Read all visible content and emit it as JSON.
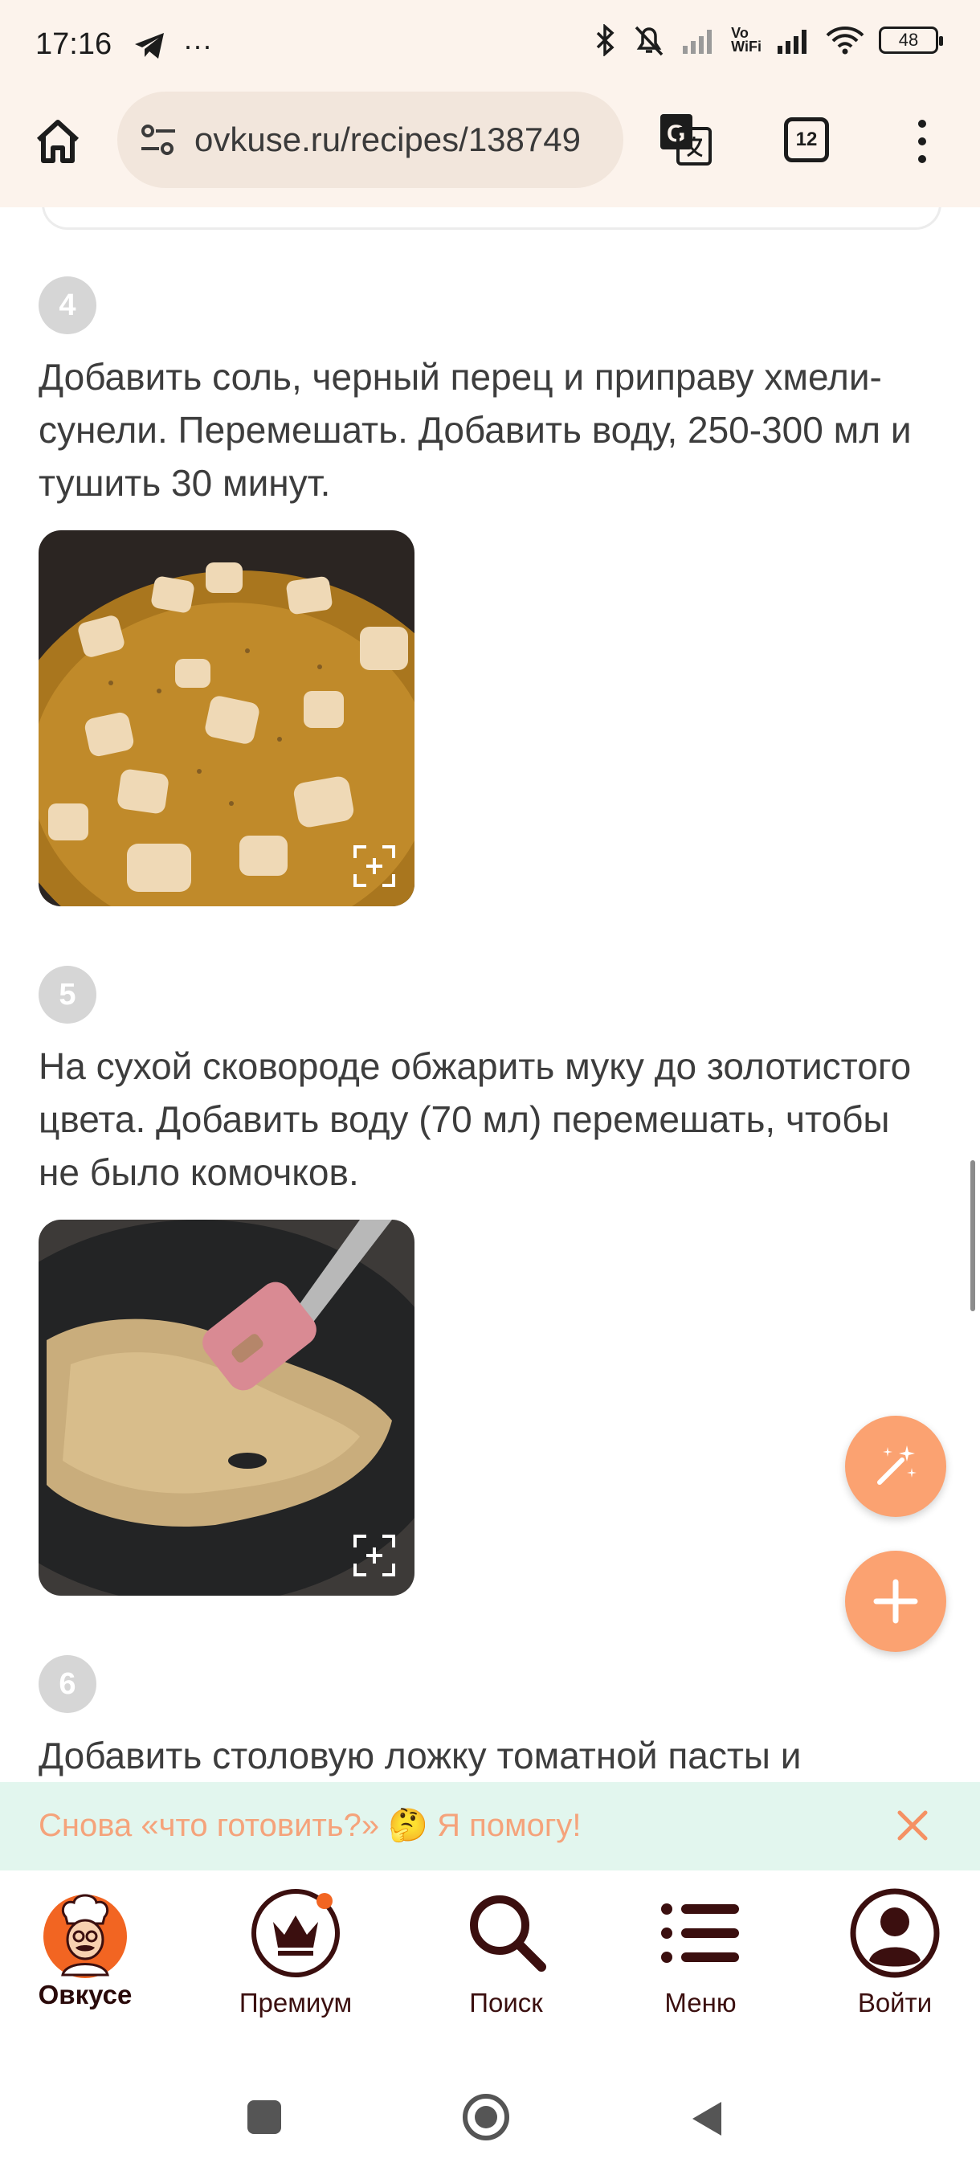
{
  "status_bar": {
    "time": "17:16",
    "left_icons": [
      "telegram-icon",
      "more-notifications"
    ],
    "more_label": "···",
    "vowifi_label": "Vo\nWiFi",
    "battery": "48"
  },
  "browser": {
    "url": "ovkuse.ru/recipes/138749",
    "tabs_count": "12"
  },
  "steps": [
    {
      "number": "4",
      "text": "Добавить соль, черный перец и приправу хмели-сунели. Перемешать. Добавить воду, 250-300 мл и тушить 30 минут."
    },
    {
      "number": "5",
      "text": "На сухой сковороде обжарить муку до золотистого цвета. Добавить воду (70 мл) перемешать, чтобы не было комочков."
    },
    {
      "number": "6",
      "text": "Добавить столовую ложку томатной пасты и"
    }
  ],
  "promo": {
    "text": "Снова «что готовить?» 🤔 Я помогу!"
  },
  "bottom_nav": {
    "items": [
      {
        "label": "Овкусе",
        "icon": "chef-logo-icon"
      },
      {
        "label": "Премиум",
        "icon": "crown-icon"
      },
      {
        "label": "Поиск",
        "icon": "search-icon"
      },
      {
        "label": "Меню",
        "icon": "menu-list-icon"
      },
      {
        "label": "Войти",
        "icon": "user-icon"
      }
    ]
  },
  "colors": {
    "browser_bg": "#fcf3ec",
    "accent_orange": "#fba271",
    "promo_bg": "#e2f6ee",
    "promo_text": "#f5a37b",
    "nav_text": "#3b0f0f"
  }
}
